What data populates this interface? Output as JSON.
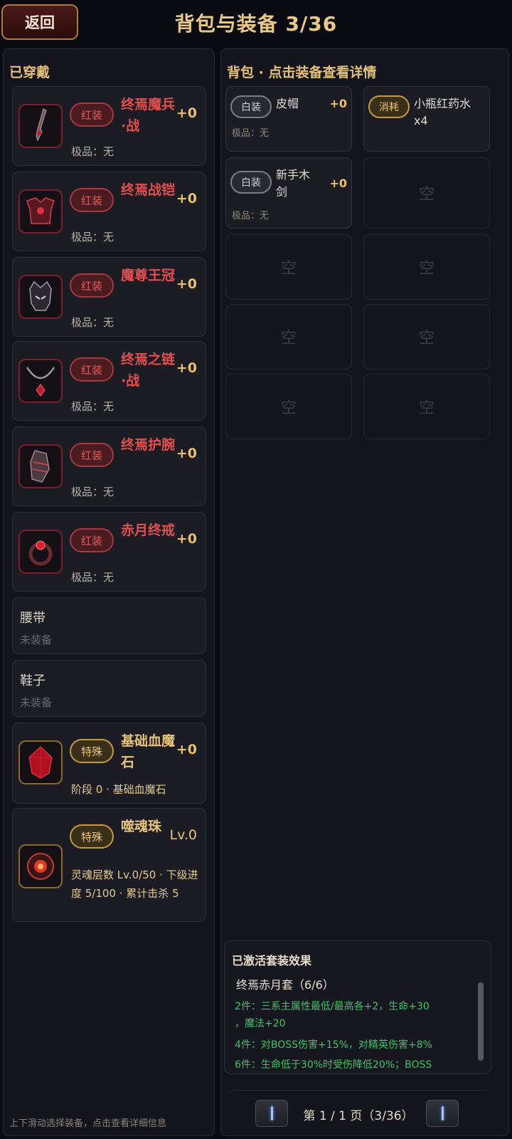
{
  "header": {
    "back_label": "返回",
    "title": "背包与装备 3/36"
  },
  "equipped": {
    "section_title": "已穿戴",
    "items": [
      {
        "badge": "红装",
        "name": "终焉魔兵·战",
        "plus": "+0",
        "sub": "极品：无",
        "icon": "blade-icon"
      },
      {
        "badge": "红装",
        "name": "终焉战铠",
        "plus": "+0",
        "sub": "极品：无",
        "icon": "armor-icon"
      },
      {
        "badge": "红装",
        "name": "魔尊王冠",
        "plus": "+0",
        "sub": "极品：无",
        "icon": "crown-icon"
      },
      {
        "badge": "红装",
        "name": "终焉之链·战",
        "plus": "+0",
        "sub": "极品：无",
        "icon": "necklace-icon"
      },
      {
        "badge": "红装",
        "name": "终焉护腕",
        "plus": "+0",
        "sub": "极品：无",
        "icon": "bracer-icon"
      },
      {
        "badge": "红装",
        "name": "赤月终戒",
        "plus": "+0",
        "sub": "极品：无",
        "icon": "ring-icon"
      }
    ],
    "empty_slots": [
      {
        "name": "腰带",
        "state": "未装备"
      },
      {
        "name": "鞋子",
        "state": "未装备"
      }
    ],
    "special": [
      {
        "badge": "特殊",
        "name": "基础血魔石",
        "plus": "+0",
        "sub": "阶段 0 · 基础血魔石",
        "icon": "blood-stone-icon"
      },
      {
        "badge": "特殊",
        "name": "噬魂珠",
        "plus": "Lv.0",
        "sub": "灵魂层数 Lv.0/50 · 下级进度 5/100 · 累计击杀 5",
        "icon": "soul-orb-icon"
      }
    ],
    "footer_hint": "上下滑动选择装备，点击查看详细信息"
  },
  "bag": {
    "section_title": "背包 · 点击装备查看详情",
    "items": [
      {
        "badge": "白装",
        "badge_type": "white",
        "name": "皮帽",
        "plus": "+0",
        "sub": "极品：无"
      },
      {
        "badge": "消耗",
        "badge_type": "gold",
        "name": "小瓶红药水 x4",
        "plus": "",
        "sub": ""
      },
      {
        "badge": "白装",
        "badge_type": "white",
        "name": "新手木剑",
        "plus": "+0",
        "sub": "极品：无"
      }
    ],
    "empty_label": "空"
  },
  "set_effects": {
    "title": "已激活套装效果",
    "set_name": "终焉赤月套（6/6）",
    "lines": [
      "2件：三系主属性最低/最高各+2，生命+30",
      "，魔法+20",
      "4件：对BOSS伤害+15%，对精英伤害+8%",
      "6件：生命低于30%时受伤降低20%；BOSS"
    ]
  },
  "pagination": {
    "label": "第 1 / 1 页（3/36）"
  },
  "colors": {
    "red_text": "#e14f4f",
    "gold_text": "#e6c27c",
    "green_text": "#43c06a",
    "panel_bg": "#14151c"
  }
}
